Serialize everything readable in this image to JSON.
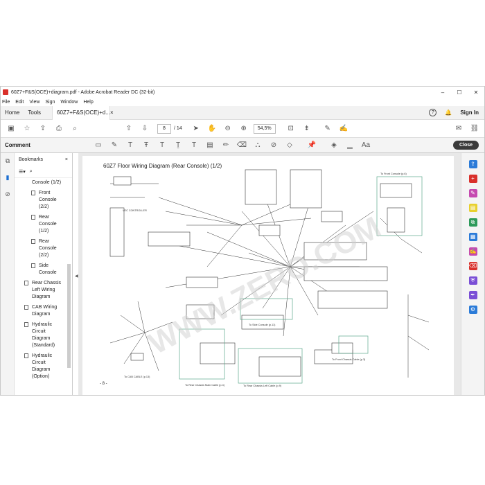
{
  "window": {
    "title": "60Z7+F&S(OCE)+diagram.pdf - Adobe Acrobat Reader DC (32-bit)",
    "minimize": "–",
    "maximize": "☐",
    "close": "✕"
  },
  "menu": [
    "File",
    "Edit",
    "View",
    "Sign",
    "Window",
    "Help"
  ],
  "tabs": {
    "home": "Home",
    "tools": "Tools",
    "document": "60Z7+F&S(OCE)+d...",
    "doc_close": "×",
    "help": "?",
    "bell": "🔔",
    "signin": "Sign In"
  },
  "toolbar": {
    "page_current": "8",
    "page_total": "/ 14",
    "zoom": "54,5%"
  },
  "comment_bar": {
    "label": "Comment",
    "close": "Close"
  },
  "bookmarks": {
    "header": "Bookmarks",
    "close": "×",
    "items": [
      {
        "label": "Console (1/2)",
        "cont": true
      },
      {
        "label": "Front Console (2/2)",
        "cont": false
      },
      {
        "label": "Rear Console (1/2)",
        "cont": false
      },
      {
        "label": "Rear Console (2/2)",
        "cont": false
      },
      {
        "label": "Side Console",
        "cont": false
      },
      {
        "label": "Rear Chassis Left Wiring Diagram",
        "cont": false,
        "flat": true
      },
      {
        "label": "CAB Wiring Diagram",
        "cont": false,
        "flat": true
      },
      {
        "label": "Hydraulic Circuit Diagram (Standard)",
        "cont": false,
        "flat": true
      },
      {
        "label": "Hydraulic Circuit Diagram (Option)",
        "cont": false,
        "flat": true
      }
    ]
  },
  "page": {
    "title": "60Z7 Floor Wiring Diagram (Rear Console) (1/2)",
    "page_number": "- 8 -",
    "labels": {
      "front_console": "To Front Console (p.6)",
      "side_console": "To Side Console (p.11)",
      "cab_cable": "To CAB CABLE (p.13)",
      "rear_chassis_main": "To Rear Chassis Main Cable (p.4)",
      "rear_chassis_left": "To Rear Chassis Left Cable (p.9)",
      "front_chassis": "To Front Chassis Cable (p.3)",
      "controller": "VEC CONTROLLER",
      "watermark": "WWW.ZERO.COM"
    }
  },
  "colors": {
    "accent_red": "#d9302b",
    "green_region": "#5aa88a",
    "highlight": "#e8d02e"
  }
}
